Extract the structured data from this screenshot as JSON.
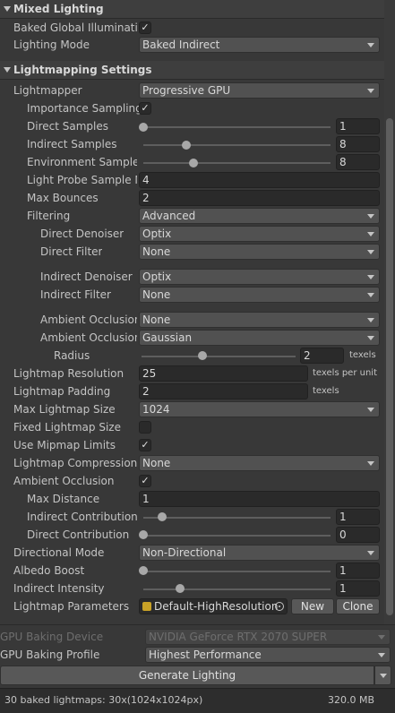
{
  "mixed_lighting": {
    "header": "Mixed Lighting",
    "baked_gi_label": "Baked Global Illumination",
    "baked_gi_checked": "✓",
    "lighting_mode_label": "Lighting Mode",
    "lighting_mode_value": "Baked Indirect"
  },
  "lightmapping": {
    "header": "Lightmapping Settings",
    "lightmapper_label": "Lightmapper",
    "lightmapper_value": "Progressive GPU",
    "importance_sampling_label": "Importance Sampling",
    "importance_sampling_checked": "✓",
    "direct_samples_label": "Direct Samples",
    "direct_samples_value": "1",
    "indirect_samples_label": "Indirect Samples",
    "indirect_samples_value": "8",
    "environment_samples_label": "Environment Samples",
    "environment_samples_value": "8",
    "light_probe_label": "Light Probe Sample Multiplier",
    "light_probe_value": "4",
    "max_bounces_label": "Max Bounces",
    "max_bounces_value": "2",
    "filtering_label": "Filtering",
    "filtering_value": "Advanced",
    "direct_denoiser_label": "Direct Denoiser",
    "direct_denoiser_value": "Optix",
    "direct_filter_label": "Direct Filter",
    "direct_filter_value": "None",
    "indirect_denoiser_label": "Indirect Denoiser",
    "indirect_denoiser_value": "Optix",
    "indirect_filter_label": "Indirect Filter",
    "indirect_filter_value": "None",
    "ao_denoiser_label": "Ambient Occlusion",
    "ao_denoiser_value": "None",
    "ao_filter_label": "Ambient Occlusion",
    "ao_filter_value": "Gaussian",
    "radius_label": "Radius",
    "radius_value": "2",
    "radius_unit": "texels",
    "lightmap_resolution_label": "Lightmap Resolution",
    "lightmap_resolution_value": "25",
    "lightmap_resolution_unit": "texels per unit",
    "lightmap_padding_label": "Lightmap Padding",
    "lightmap_padding_value": "2",
    "lightmap_padding_unit": "texels",
    "max_lightmap_size_label": "Max Lightmap Size",
    "max_lightmap_size_value": "1024",
    "fixed_lightmap_size_label": "Fixed Lightmap Size",
    "fixed_lightmap_size_checked": "",
    "use_mipmap_limits_label": "Use Mipmap Limits",
    "use_mipmap_limits_checked": "✓",
    "lightmap_compression_label": "Lightmap Compression",
    "lightmap_compression_value": "None",
    "ambient_occlusion_label": "Ambient Occlusion",
    "ambient_occlusion_checked": "✓",
    "max_distance_label": "Max Distance",
    "max_distance_value": "1",
    "indirect_contribution_label": "Indirect Contribution",
    "indirect_contribution_value": "1",
    "direct_contribution_label": "Direct Contribution",
    "direct_contribution_value": "0",
    "directional_mode_label": "Directional Mode",
    "directional_mode_value": "Non-Directional",
    "albedo_boost_label": "Albedo Boost",
    "albedo_boost_value": "1",
    "indirect_intensity_label": "Indirect Intensity",
    "indirect_intensity_value": "1",
    "lightmap_parameters_label": "Lightmap Parameters",
    "lightmap_parameters_value": "Default-HighResolution",
    "new_button": "New",
    "clone_button": "Clone"
  },
  "baking": {
    "gpu_device_label": "GPU Baking Device",
    "gpu_device_value": "NVIDIA GeForce RTX 2070 SUPER",
    "gpu_profile_label": "GPU Baking Profile",
    "gpu_profile_value": "Highest Performance",
    "generate_button": "Generate Lighting"
  },
  "status": {
    "summary": "30 baked lightmaps: 30x(1024x1024px)",
    "size": "320.0 MB"
  },
  "icons": [
    "foldout-arrow-icon",
    "dropdown-arrow-icon",
    "checkmark-icon",
    "asset-icon",
    "object-picker-icon"
  ]
}
